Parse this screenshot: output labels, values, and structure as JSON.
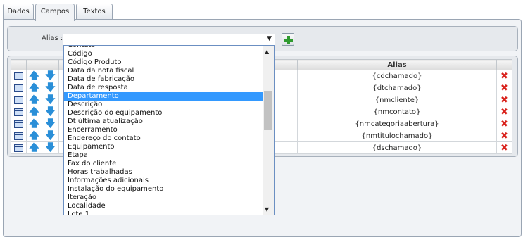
{
  "tabs": [
    {
      "label": "Dados"
    },
    {
      "label": "Campos"
    },
    {
      "label": "Textos"
    }
  ],
  "alias_label": "Alias :",
  "select_arrow": "▼",
  "grid": {
    "header": {
      "alias": "Alias"
    },
    "rows": [
      {
        "alias": "{cdchamado}"
      },
      {
        "alias": "{dtchamado}"
      },
      {
        "alias": "{nmcliente}"
      },
      {
        "alias": "{nmcontato}"
      },
      {
        "alias": "{nmcategoriaabertura}"
      },
      {
        "alias": "{nmtitulochamado}"
      },
      {
        "alias": "{dschamado}"
      }
    ]
  },
  "dropdown": {
    "items": [
      "Contato",
      "Código",
      "Código Produto",
      "Data da nota fiscal",
      "Data de fabricação",
      "Data de resposta",
      "Departamento",
      "Descrição",
      "Descrição do equipamento",
      "Dt última atualização",
      "Encerramento",
      "Endereço do contato",
      "Equipamento",
      "Etapa",
      "Fax do cliente",
      "Horas trabalhadas",
      "Informações adicionais",
      "Instalação do equipamento",
      "Iteração",
      "Localidade",
      "Lote 1"
    ],
    "selected_index": 6
  },
  "colors": {
    "selection": "#3399ff",
    "delete": "#d9221c",
    "arrow": "#2a8fd8"
  }
}
